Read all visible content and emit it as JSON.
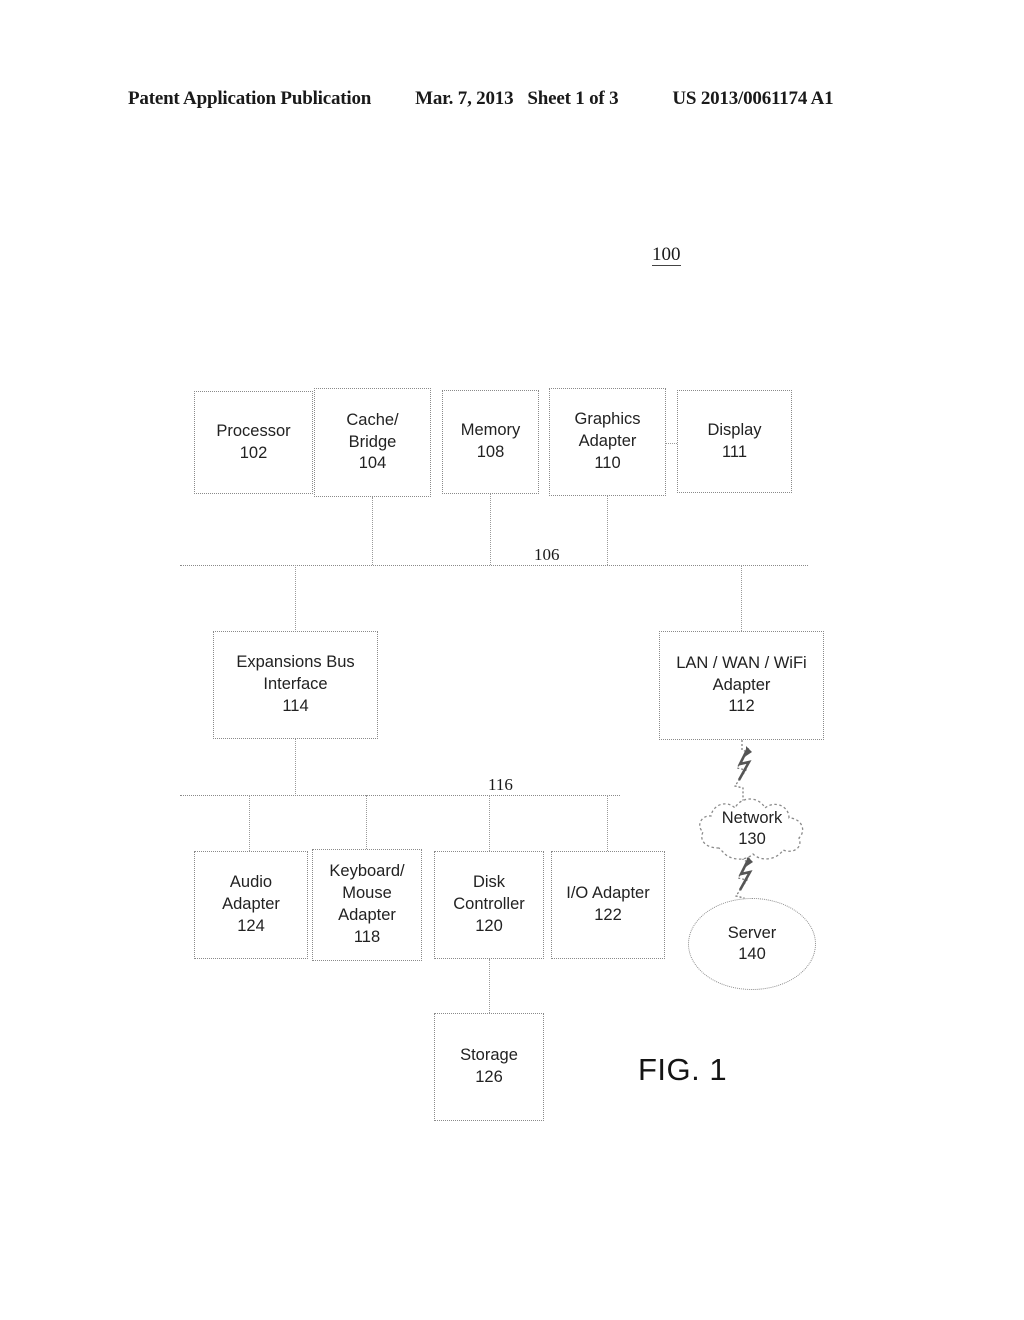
{
  "header": {
    "publication": "Patent Application Publication",
    "date": "Mar. 7, 2013",
    "sheet": "Sheet 1 of 3",
    "patent_number": "US 2013/0061174 A1"
  },
  "figure": {
    "reference_numeral": "100",
    "caption": "FIG. 1"
  },
  "buses": [
    {
      "id": "bus-106",
      "label": "106"
    },
    {
      "id": "bus-116",
      "label": "116"
    }
  ],
  "nodes": {
    "processor": {
      "label": "Processor",
      "num": "102"
    },
    "cache_bridge": {
      "label_1": "Cache/",
      "label_2": "Bridge",
      "num": "104"
    },
    "memory": {
      "label": "Memory",
      "num": "108"
    },
    "graphics_adapter": {
      "label_1": "Graphics",
      "label_2": "Adapter",
      "num": "110"
    },
    "display": {
      "label": "Display",
      "num": "111"
    },
    "expansions_bus": {
      "label_1": "Expansions Bus",
      "label_2": "Interface",
      "num": "114"
    },
    "lan_wan_wifi": {
      "label_1": "LAN / WAN / WiFi",
      "label_2": "Adapter",
      "num": "112"
    },
    "audio_adapter": {
      "label_1": "Audio",
      "label_2": "Adapter",
      "num": "124"
    },
    "keyboard_mouse": {
      "label_1": "Keyboard/",
      "label_2": "Mouse",
      "label_3": "Adapter",
      "num": "118"
    },
    "disk_controller": {
      "label_1": "Disk",
      "label_2": "Controller",
      "num": "120"
    },
    "io_adapter": {
      "label": "I/O Adapter",
      "num": "122"
    },
    "storage": {
      "label": "Storage",
      "num": "126"
    },
    "network": {
      "label": "Network",
      "num": "130"
    },
    "server": {
      "label": "Server",
      "num": "140"
    }
  },
  "colors": {
    "line": "#8a8a8a",
    "text": "#222222",
    "background": "#ffffff"
  }
}
